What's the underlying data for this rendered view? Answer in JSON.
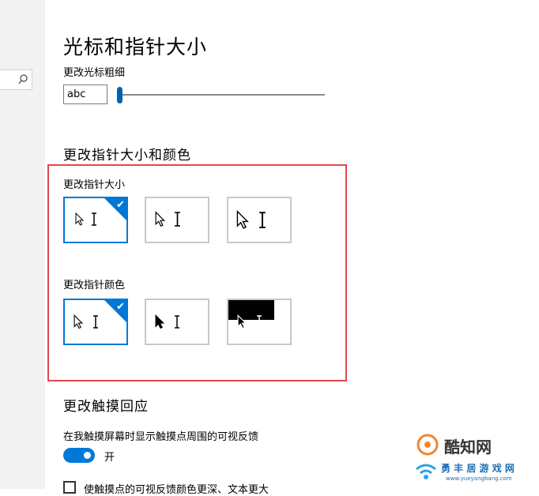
{
  "sidebar": {
    "search_icon": "search-icon"
  },
  "cursor_section": {
    "title": "光标和指针大小",
    "thickness_label": "更改光标粗细",
    "preview_value": "abc",
    "thickness_level": 0.02
  },
  "pointer_section": {
    "title": "更改指针大小和颜色",
    "size_label": "更改指针大小",
    "size_options": [
      {
        "name": "small",
        "selected": true
      },
      {
        "name": "medium",
        "selected": false
      },
      {
        "name": "large",
        "selected": false
      }
    ],
    "color_label": "更改指针颜色",
    "color_options": [
      {
        "name": "white",
        "selected": true
      },
      {
        "name": "black",
        "selected": false
      },
      {
        "name": "inverted",
        "selected": false
      }
    ]
  },
  "touch_section": {
    "title": "更改触摸回应",
    "feedback_label": "在我触摸屏幕时显示触摸点周围的可视反馈",
    "toggle_state": "开",
    "checkbox_label": "使触摸点的可视反馈颜色更深、文本更大"
  },
  "watermark": {
    "brand": "酷知网",
    "subtitle": "勇 丰 居 游 戏 网",
    "url": "www.yueyangbang.com"
  },
  "colors": {
    "accent": "#0078d7",
    "frame": "#e0484e"
  }
}
